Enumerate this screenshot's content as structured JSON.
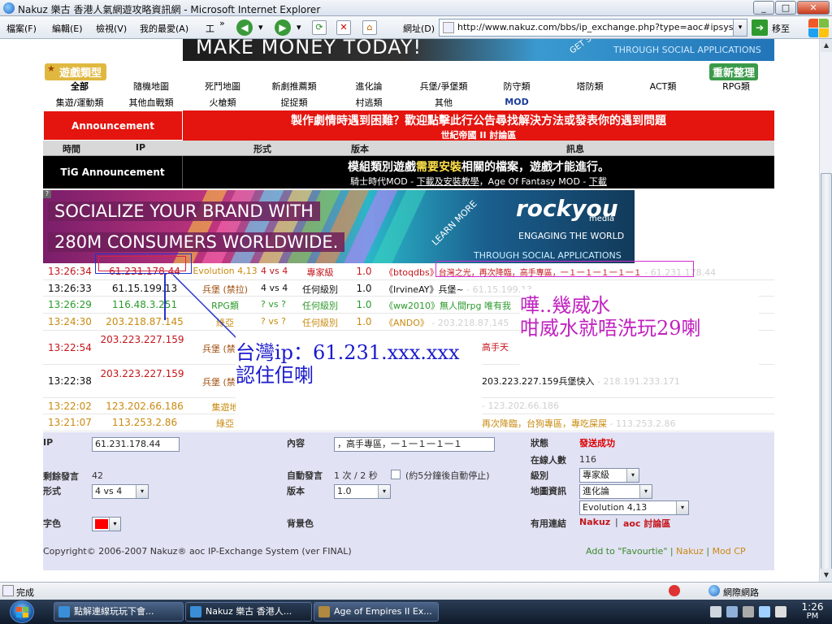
{
  "window": {
    "title": "Nakuz 樂古 香港人氣網遊攻略資訊網 - Microsoft Internet Explorer",
    "minimize_glyph": "_",
    "maximize_glyph": "□",
    "close_glyph": "✕"
  },
  "menu": {
    "items": [
      "檔案(F)",
      "編輯(E)",
      "檢視(V)",
      "我的最愛(A)",
      "工"
    ],
    "more": "»"
  },
  "toolbar": {
    "back_glyph": "◀",
    "forward_glyph": "▶",
    "dropdown_glyph": "▾",
    "address_label": "網址(D)",
    "url": "http://www.nakuz.com/bbs/ip_exchange.php?type=aoc#ipsyste",
    "go_label": "移至",
    "go_glyph": "➔"
  },
  "top_banner": {
    "text": "MAKE MONEY TODAY!",
    "corner": "GET S",
    "right": "THROUGH SOCIAL APPLICATIONS"
  },
  "categories": {
    "header": "遊戲類型",
    "refresh": "重新整理",
    "row1": [
      "全部",
      "隨機地圖",
      "死鬥地圖",
      "新劇推薦類",
      "進化論",
      "兵堡/爭堡類",
      "防守類",
      "塔防類",
      "ACT類",
      "RPG類"
    ],
    "row2": [
      "集遊/運動類",
      "其他血戰類",
      "火槍類",
      "捉捉類",
      "村逃類",
      "其他",
      "MOD"
    ]
  },
  "announcement": {
    "label": "Announcement",
    "line1": "製作劇情時遇到困難？歡迎點擊此行公告尋找解決方法或發表你的遇到問題",
    "line2": "世紀帝國 II 討論區"
  },
  "columns": {
    "time": "時間",
    "ip": "IP",
    "type": "形式",
    "version": "版本",
    "message": "訊息"
  },
  "tig": {
    "label": "TiG Announcement",
    "line1_a": "模組類別遊戲",
    "line1_hl": "需要安裝",
    "line1_b": "相關的檔案，遊戲才能進行。",
    "line2_a": "騎士時代MOD - ",
    "line2_link1": "下載及安裝教學",
    "line2_b": "，Age Of Fantasy MOD - ",
    "line2_link2": "下載"
  },
  "rock_banner": {
    "q": "?",
    "line1": "SOCIALIZE YOUR BRAND WITH",
    "line2": "280M CONSUMERS WORLDWIDE.",
    "learn": "LEARN MORE",
    "logo": "rockyou",
    "media": "media",
    "engaging1": "ENGAGING THE WORLD",
    "engaging2": "THROUGH SOCIAL APPLICATIONS"
  },
  "rows": [
    {
      "time": "13:26:34",
      "ip": "61.231.178.44",
      "type": "Evolution 4,13",
      "vs": "4 vs 4",
      "level": "專家級",
      "version": "1.0",
      "msg": "《btoqdbs》",
      "msg_boxed": "台灣之光，再次降臨，高手專區，一１一１一１一１一１",
      "msg_faint": " - 61.231.178.44"
    },
    {
      "time": "13:26:33",
      "ip": "61.15.199.13",
      "type": "兵堡 (禁拉)",
      "vs": "4 vs 4",
      "level": "任何級別",
      "version": "1.0",
      "msg": "《IrvineAY》兵堡~",
      "msg_faint": " - 61.15.199.13"
    },
    {
      "time": "13:26:29",
      "ip": "116.48.3.251",
      "type": "RPG類",
      "vs": "? vs ?",
      "level": "任何級別",
      "version": "1.0",
      "msg": "《ww2010》無人間rpg 唯有我",
      "msg_faint": ""
    },
    {
      "time": "13:24:30",
      "ip": "203.218.87.145",
      "type": "綠亞",
      "vs": "? vs ?",
      "level": "任何級別",
      "version": "1.0",
      "msg": "《ANDO》",
      "msg_faint": " - 203.218.87.145"
    },
    {
      "time": "13:22:54",
      "ip": "203.223.227.159",
      "type": "兵堡 (禁拉)",
      "vs": "",
      "level": "",
      "version": "",
      "msg": "高手天",
      "msg_faint": ""
    },
    {
      "time": "13:22:38",
      "ip": "203.223.227.159",
      "type": "兵堡 (禁拉)",
      "vs": "",
      "level": "",
      "version": "",
      "msg": "203.223.227.159兵堡快入",
      "msg_faint": " - 218.191.233.171"
    },
    {
      "time": "13:22:02",
      "ip": "123.202.66.186",
      "type": "集遊地",
      "vs": "",
      "level": "",
      "version": "",
      "msg": "",
      "msg_faint": " - 123.202.66.186"
    },
    {
      "time": "13:21:07",
      "ip": "113.253.2.86",
      "type": "綠亞",
      "vs": "",
      "level": "",
      "version": "",
      "msg": "再次降臨，台狗專區，專吃屎屎",
      "msg_faint": " - 113.253.2.86"
    }
  ],
  "annotations": {
    "tw_line1": "台灣ip：61.231.xxx.xxx",
    "tw_line2": "認住佢喇",
    "wah_line1": "嘩..幾威水",
    "wah_line2": "咁威水就唔洗玩29喇"
  },
  "form": {
    "ip_label": "IP",
    "ip_value": "61.231.178.44",
    "content_label": "內容",
    "content_value": "，高手專區，一１一１一１一１",
    "status_label": "狀態",
    "status_value": "發送成功",
    "online_label": "在線人數",
    "online_value": "116",
    "remaining_label": "剩餘發言",
    "remaining_value": "42",
    "auto_label": "自動發言",
    "auto_value": "1 次 / 2 秒",
    "auto_note": "(約5分鐘後自動停止)",
    "level_label": "級別",
    "level_value": "專家級",
    "format_label": "形式",
    "format_value": "4 vs 4",
    "version_label": "版本",
    "version_value": "1.0",
    "map_label": "地圖資訊",
    "map_value1": "進化論",
    "map_value2": "Evolution 4,13",
    "fontcolor_label": "字色",
    "bgcolor_label": "背景色",
    "links_label": "有用連結",
    "link1": "Nakuz",
    "link_sep": "|",
    "link2": "aoc 討論區",
    "dd_glyph": "▾"
  },
  "footer": {
    "copyright": "Copyright© 2006-2007  Nakuz® aoc IP-Exchange System (ver FINAL)",
    "fav": "Add to \"Favourtie\"",
    "sep": "|",
    "nakuz": "Nakuz",
    "mod": "Mod CP"
  },
  "status_bar": {
    "done": "完成",
    "zone": "網際網路"
  },
  "taskbar": {
    "tasks": [
      "點解連線玩玩下會...",
      "Nakuz 樂古 香港人...",
      "Age of Empires II Ex..."
    ],
    "time": "1:26",
    "ampm": "PM"
  },
  "colors": {
    "announcement_red": "#e4140e",
    "annotation_blue": "#1a1acc",
    "annotation_magenta": "#c022c0",
    "form_bg": "#e2e2f5"
  }
}
